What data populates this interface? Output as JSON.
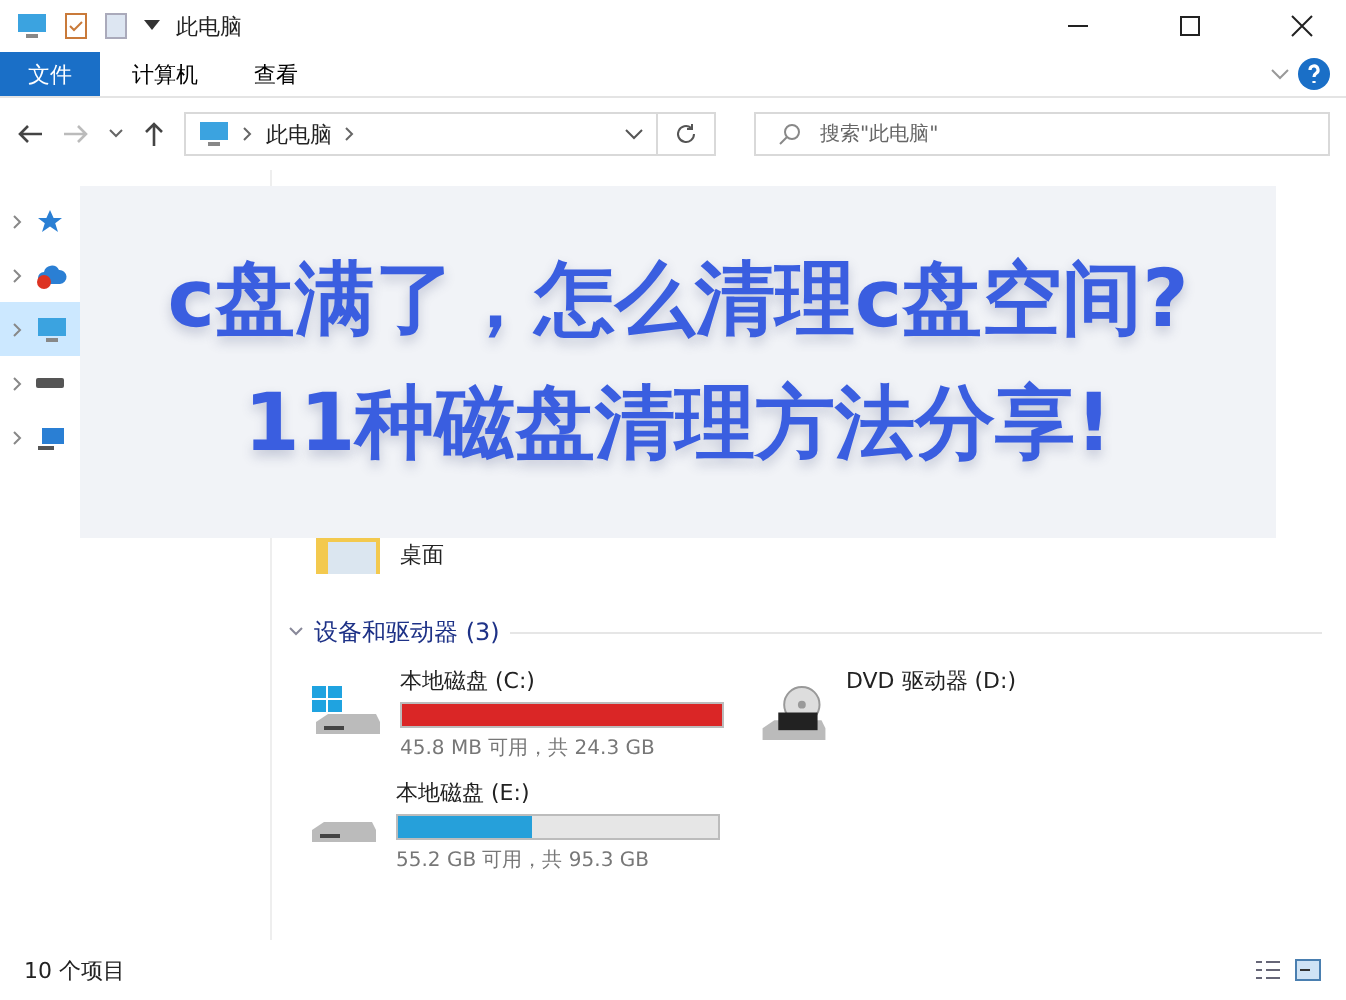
{
  "window": {
    "title": "此电脑"
  },
  "ribbon_tabs": [
    {
      "label": "文件",
      "selected": true
    },
    {
      "label": "计算机",
      "selected": false
    },
    {
      "label": "查看",
      "selected": false
    }
  ],
  "address": {
    "path": "此电脑"
  },
  "search": {
    "placeholder": "搜索\"此电脑\""
  },
  "sidebar": {
    "items": [
      {
        "kind": "star",
        "selected": false
      },
      {
        "kind": "cloud",
        "selected": false
      },
      {
        "kind": "pc",
        "selected": true
      },
      {
        "kind": "drive",
        "selected": false
      },
      {
        "kind": "network",
        "selected": false
      }
    ]
  },
  "folders_group": {
    "items": [
      {
        "label": "桌面"
      }
    ]
  },
  "drives_group": {
    "title": "设备和驱动器 (3)",
    "items": [
      {
        "kind": "system",
        "name": "本地磁盘 (C:)",
        "level": 0.998,
        "full": true,
        "info": "45.8 MB 可用，共 24.3 GB"
      },
      {
        "kind": "dvd",
        "name": "DVD 驱动器 (D:)"
      },
      {
        "kind": "disk",
        "name": "本地磁盘 (E:)",
        "level": 0.42,
        "full": false,
        "info": "55.2 GB 可用，共 95.3 GB"
      }
    ]
  },
  "banner": {
    "lines": [
      "c盘满了，怎么清理c盘空间?",
      "11种磁盘清理方法分享!"
    ]
  },
  "status_bar": {
    "count": "10 个项目"
  }
}
